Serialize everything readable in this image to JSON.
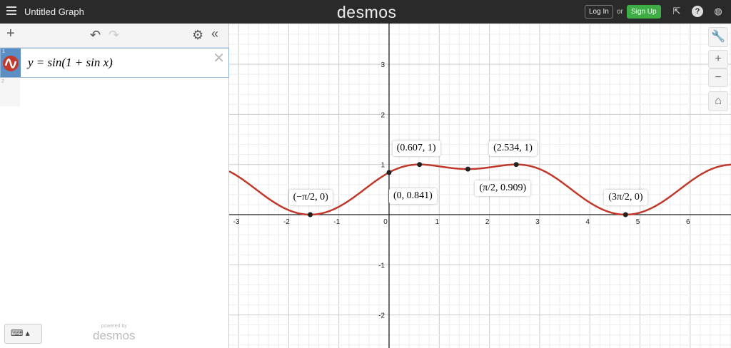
{
  "header": {
    "title": "Untitled Graph",
    "logo": "desmos",
    "login": "Log In",
    "or": "or",
    "signup": "Sign Up",
    "icons": [
      "share-icon",
      "help-icon",
      "globe-icon"
    ]
  },
  "panel": {
    "expressions": [
      {
        "index": "1",
        "latex": "y = sin(1 + sin x)",
        "color": "#c0392b"
      },
      {
        "index": "2",
        "latex": ""
      }
    ],
    "powered_by": "powered by",
    "powered_logo": "desmos"
  },
  "graph": {
    "curve_color": "#c0392b",
    "x_ticks": [
      "-3",
      "-2",
      "-1",
      "0",
      "1",
      "2",
      "3",
      "4",
      "5",
      "6"
    ],
    "y_ticks": [
      "3",
      "2",
      "1",
      "-1",
      "-2"
    ],
    "points": [
      {
        "x": -1.5708,
        "y": 0,
        "label": "(−π/2, 0)"
      },
      {
        "x": 0,
        "y": 0.841,
        "label": "(0, 0.841)"
      },
      {
        "x": 0.607,
        "y": 1,
        "label": "(0.607, 1)"
      },
      {
        "x": 1.5708,
        "y": 0.909,
        "label": "(π/2, 0.909)"
      },
      {
        "x": 2.534,
        "y": 1,
        "label": "(2.534, 1)"
      },
      {
        "x": 4.7124,
        "y": 0,
        "label": "(3π/2, 0)"
      }
    ]
  }
}
